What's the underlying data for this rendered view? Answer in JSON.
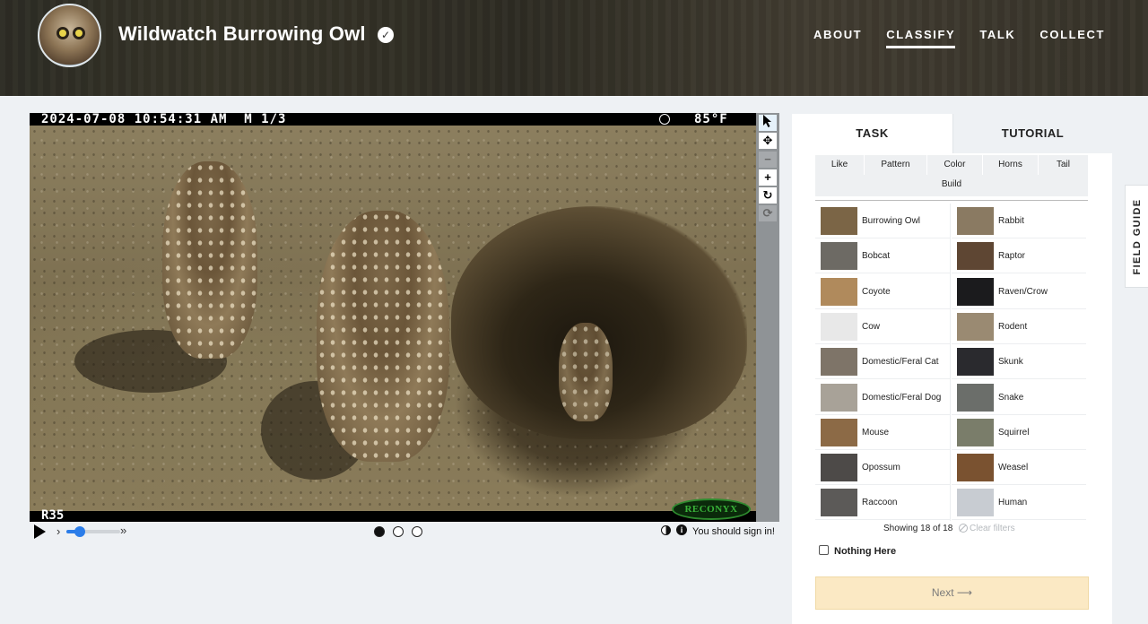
{
  "header": {
    "project_title": "Wildwatch Burrowing Owl",
    "nav": [
      "ABOUT",
      "CLASSIFY",
      "TALK",
      "COLLECT"
    ],
    "active_nav": "CLASSIFY"
  },
  "viewer": {
    "camera_stamp": "2024-07-08 10:54:31 AM  M 1/3",
    "temperature": "85°F",
    "camera_id": "R35",
    "logo_text": "RECONYX",
    "tools": [
      "pointer-icon",
      "move-icon",
      "zoom-out-icon",
      "zoom-in-icon",
      "rotate-icon",
      "reset-icon"
    ],
    "playback_speed_fraction": 0.25,
    "frames": 3,
    "current_frame": 1,
    "sign_in_message": "You should sign in!"
  },
  "panel": {
    "tabs": {
      "task": "TASK",
      "tutorial": "TUTORIAL"
    },
    "filters": [
      "Like",
      "Pattern",
      "Color",
      "Horns",
      "Tail",
      "Build"
    ],
    "choices": [
      {
        "label": "Burrowing Owl",
        "thumb_color": "#7b6546"
      },
      {
        "label": "Rabbit",
        "thumb_color": "#8a7a62"
      },
      {
        "label": "Bobcat",
        "thumb_color": "#6d6a64"
      },
      {
        "label": "Raptor",
        "thumb_color": "#5e4633"
      },
      {
        "label": "Coyote",
        "thumb_color": "#b08a5c"
      },
      {
        "label": "Raven/Crow",
        "thumb_color": "#1b1b1d"
      },
      {
        "label": "Cow",
        "thumb_color": "#e8e8e8"
      },
      {
        "label": "Rodent",
        "thumb_color": "#9a8a72"
      },
      {
        "label": "Domestic/Feral Cat",
        "thumb_color": "#7e7468"
      },
      {
        "label": "Skunk",
        "thumb_color": "#2a2a2e"
      },
      {
        "label": "Domestic/Feral Dog",
        "thumb_color": "#a8a298"
      },
      {
        "label": "Snake",
        "thumb_color": "#6b6e6a"
      },
      {
        "label": "Mouse",
        "thumb_color": "#8c6a46"
      },
      {
        "label": "Squirrel",
        "thumb_color": "#7a7d6a"
      },
      {
        "label": "Opossum",
        "thumb_color": "#4d4a48"
      },
      {
        "label": "Weasel",
        "thumb_color": "#7a5230"
      },
      {
        "label": "Raccoon",
        "thumb_color": "#5c5a58"
      },
      {
        "label": "Human",
        "thumb_color": "#c8ccd2"
      }
    ],
    "showing_text": "Showing 18 of 18",
    "clear_filters": "Clear filters",
    "nothing_here": "Nothing Here",
    "next_label": "Next ⟶"
  },
  "field_guide": "FIELD GUIDE",
  "colors": {
    "accent": "#2b7de9",
    "next_bg": "#fbe9c4"
  }
}
